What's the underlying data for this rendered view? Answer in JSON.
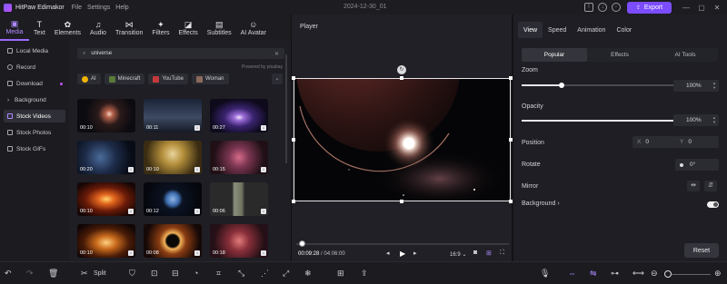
{
  "titlebar": {
    "app_name": "HitPaw Edimakor",
    "menus": [
      "File",
      "Settings",
      "Help"
    ],
    "project_name": "2024-12-30_01",
    "export_label": "Export",
    "win_controls": [
      "—",
      "▢",
      "✕"
    ]
  },
  "toolbar": {
    "tools": [
      {
        "label": "Media",
        "icon": "media-icon"
      },
      {
        "label": "Text",
        "icon": "text-icon"
      },
      {
        "label": "Elements",
        "icon": "elements-icon"
      },
      {
        "label": "Audio",
        "icon": "audio-icon"
      },
      {
        "label": "Transition",
        "icon": "transition-icon"
      },
      {
        "label": "Filters",
        "icon": "filters-icon"
      },
      {
        "label": "Effects",
        "icon": "effects-icon"
      },
      {
        "label": "Subtitles",
        "icon": "subtitles-icon"
      },
      {
        "label": "AI Avatar",
        "icon": "ai-avatar-icon"
      }
    ]
  },
  "sidebar": {
    "items": [
      "Local Media",
      "Record",
      "Download",
      "Background",
      "Stock Videos",
      "Stock Photos",
      "Stock GIFs"
    ]
  },
  "browser": {
    "search_value": "universe",
    "powered_by": "Powered by pixabay",
    "chips": [
      "AI",
      "Minecraft",
      "YouTube",
      "Woman"
    ],
    "clips": [
      {
        "duration": "00:10"
      },
      {
        "duration": "00:11"
      },
      {
        "duration": "00:27"
      },
      {
        "duration": "00:20"
      },
      {
        "duration": "00:10"
      },
      {
        "duration": "00:15"
      },
      {
        "duration": "00:10"
      },
      {
        "duration": "00:12"
      },
      {
        "duration": "00:06"
      },
      {
        "duration": "00:10"
      },
      {
        "duration": "00:08"
      },
      {
        "duration": "00:18"
      }
    ]
  },
  "player": {
    "title": "Player",
    "current_time": "00:09:28",
    "total_time": "04:06:00",
    "aspect": "16:9",
    "progress": 0.02
  },
  "properties": {
    "tabs": [
      "View",
      "Speed",
      "Animation",
      "Color"
    ],
    "subtabs": [
      "Popular",
      "Effects",
      "AI Tools"
    ],
    "zoom_label": "Zoom",
    "zoom_value": "100%",
    "zoom_level": 0.25,
    "opacity_label": "Opacity",
    "opacity_value": "100%",
    "opacity_level": 1.0,
    "position_label": "Position",
    "pos_x_label": "X",
    "pos_x_value": "0",
    "pos_y_label": "Y",
    "pos_y_value": "0",
    "rotate_label": "Rotate",
    "rotate_value": "0°",
    "mirror_label": "Mirror",
    "background_label": "Background",
    "reset_label": "Reset"
  },
  "bottom": {
    "split_label": "Split"
  }
}
